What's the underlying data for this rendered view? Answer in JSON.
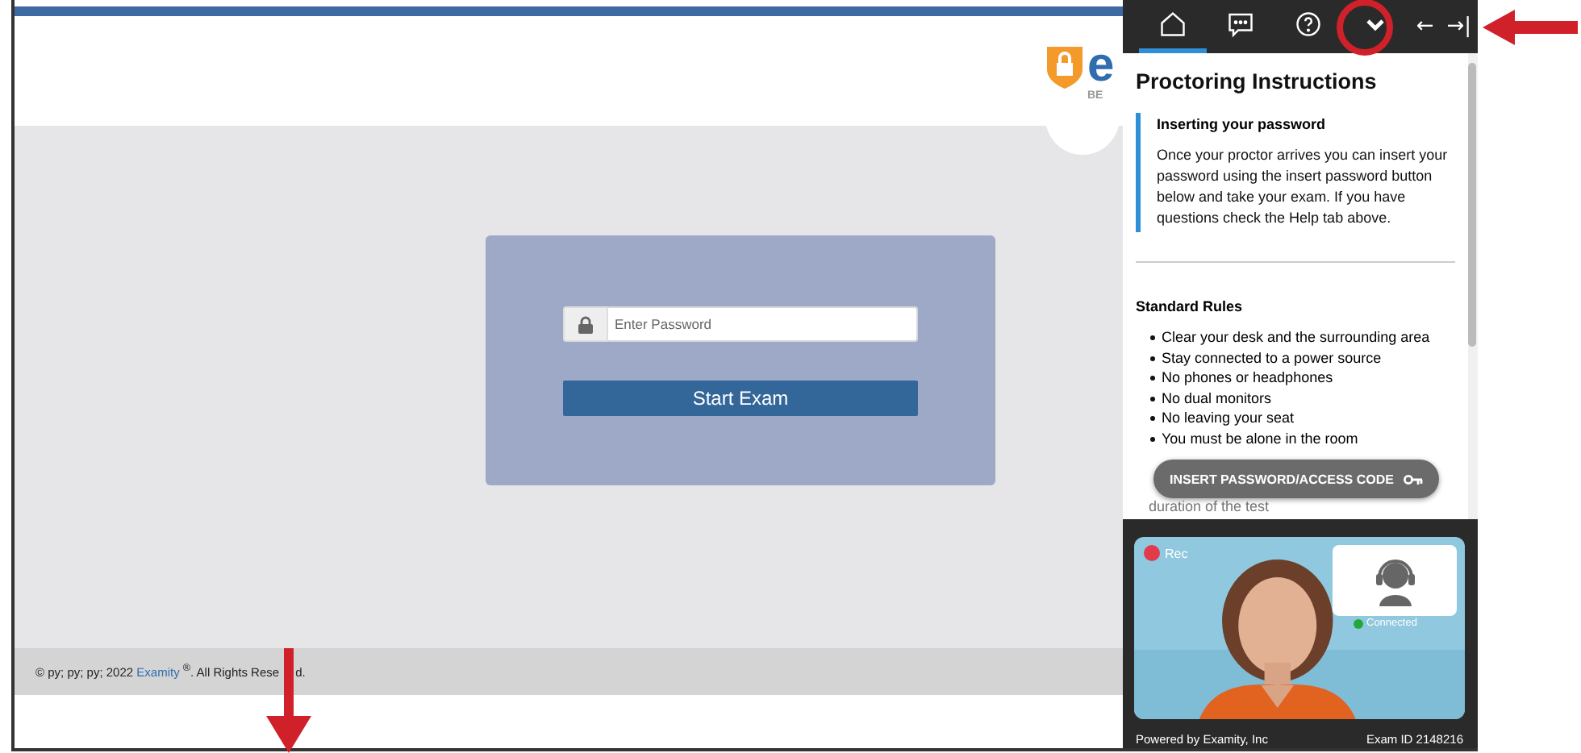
{
  "logo": {
    "letter": "e",
    "tagline": "BE"
  },
  "login": {
    "password_placeholder": "Enter Password",
    "start_button": "Start Exam"
  },
  "footer": {
    "prefix": "© py; py; py; 2022",
    "link": "Examity",
    "mark": "®",
    "suffix": ". All Rights Rese",
    "after_arrow": "d."
  },
  "panel": {
    "tabs": [
      {
        "kind": "home",
        "selected": true
      },
      {
        "kind": "chat",
        "selected": false
      },
      {
        "kind": "help",
        "selected": false
      },
      {
        "kind": "collapse",
        "selected": false
      }
    ],
    "back_arrow": "←",
    "dock_arrow": "→|",
    "title": "Proctoring Instructions",
    "note": {
      "heading": "Inserting your password",
      "body": "Once your proctor arrives you can insert your password using the insert password button below and take your exam. If you have questions check the Help tab above."
    },
    "rules_heading": "Standard Rules",
    "rules": [
      "Clear your desk and the surrounding area",
      "Stay connected to a power source",
      "No phones or headphones",
      "No dual monitors",
      "No leaving your seat",
      "You must be alone in the room"
    ],
    "rules_tail": "duration of the test",
    "insert_button": "INSERT PASSWORD/ACCESS CODE",
    "video": {
      "rec_label": "Rec",
      "proctor_status": "Connected"
    },
    "powered_by": "Powered by Examity, Inc",
    "exam_id": "Exam ID 2148216"
  }
}
